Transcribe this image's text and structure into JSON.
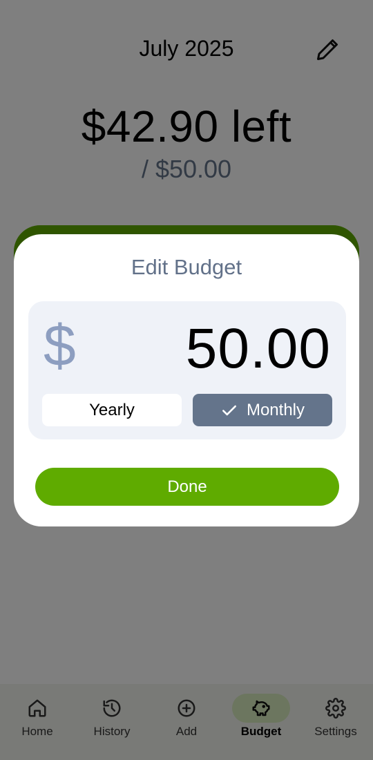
{
  "header": {
    "title": "July 2025",
    "edit_icon": "pencil-icon"
  },
  "summary": {
    "remaining": "$42.90 left",
    "total": "/ $50.00"
  },
  "colors": {
    "accent_green": "#5fab00",
    "slate": "#64748b",
    "title_blue_gray": "#627189"
  },
  "nav": {
    "items": [
      {
        "label": "Home",
        "icon": "home-icon"
      },
      {
        "label": "History",
        "icon": "history-icon"
      },
      {
        "label": "Add",
        "icon": "add-circle-icon"
      },
      {
        "label": "Budget",
        "icon": "piggy-bank-icon",
        "active": true
      },
      {
        "label": "Settings",
        "icon": "gear-icon"
      }
    ]
  },
  "dialog": {
    "title": "Edit Budget",
    "currency_symbol": "$",
    "amount": "50.00",
    "period_options": [
      {
        "label": "Yearly",
        "selected": false
      },
      {
        "label": "Monthly",
        "selected": true
      }
    ],
    "done_label": "Done"
  }
}
